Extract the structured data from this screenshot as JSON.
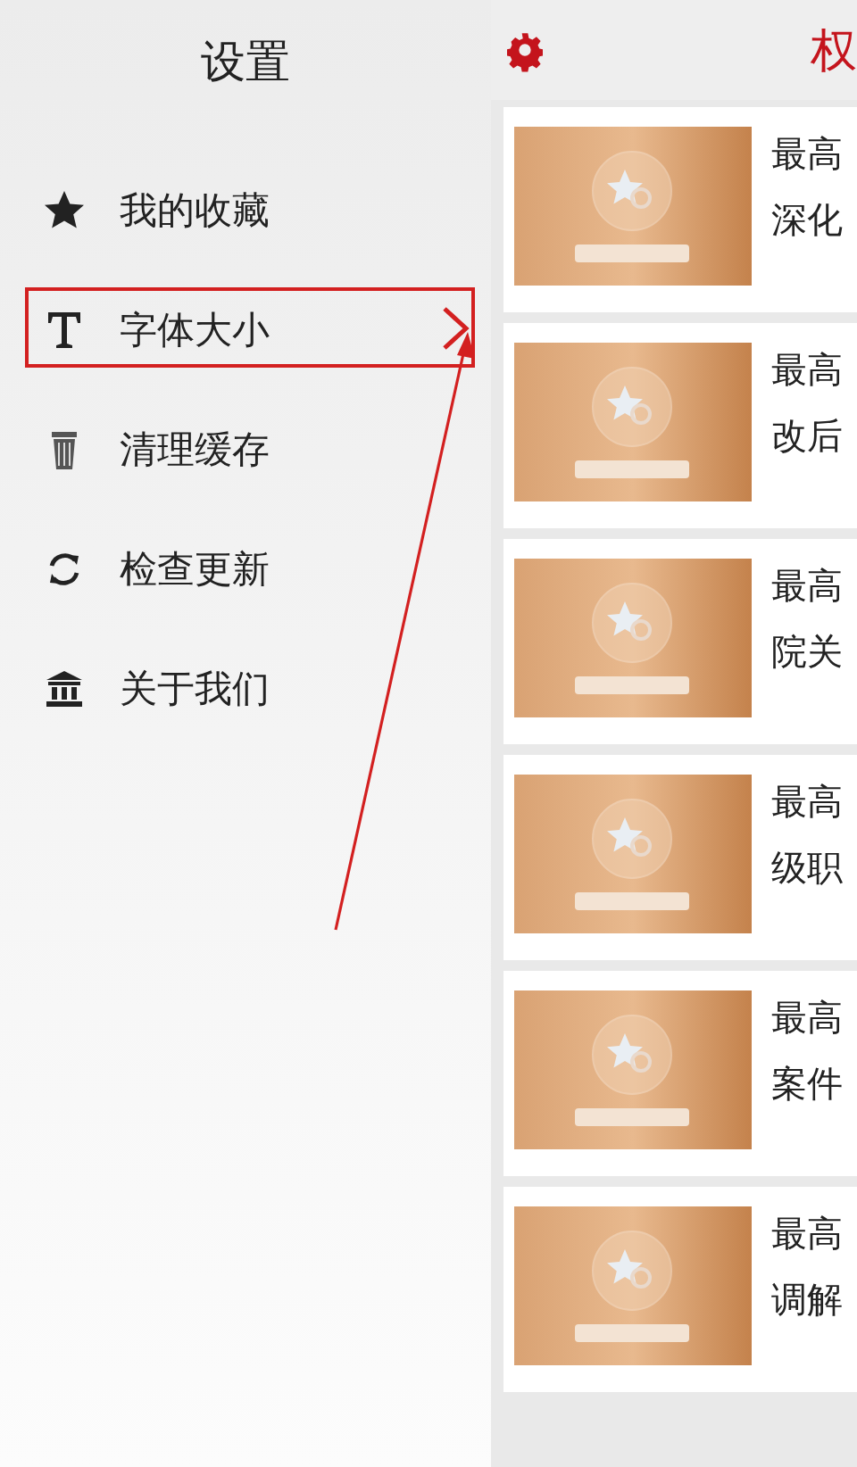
{
  "drawer": {
    "title": "设置",
    "items": [
      {
        "label": "我的收藏",
        "kind": "star",
        "highlighted": false
      },
      {
        "label": "字体大小",
        "kind": "text",
        "highlighted": true
      },
      {
        "label": "清理缓存",
        "kind": "trash",
        "highlighted": false
      },
      {
        "label": "检查更新",
        "kind": "refresh",
        "highlighted": false
      },
      {
        "label": "关于我们",
        "kind": "bank",
        "highlighted": false
      }
    ]
  },
  "main": {
    "title": "权",
    "articles": [
      {
        "line_1": "最高",
        "line_2": "深化"
      },
      {
        "line_1": "最高",
        "line_2": "改后"
      },
      {
        "line_1": "最高",
        "line_2": "院关"
      },
      {
        "line_1": "最高",
        "line_2": "级职"
      },
      {
        "line_1": "最高",
        "line_2": "案件"
      },
      {
        "line_1": "最高",
        "line_2": "调解"
      }
    ]
  }
}
